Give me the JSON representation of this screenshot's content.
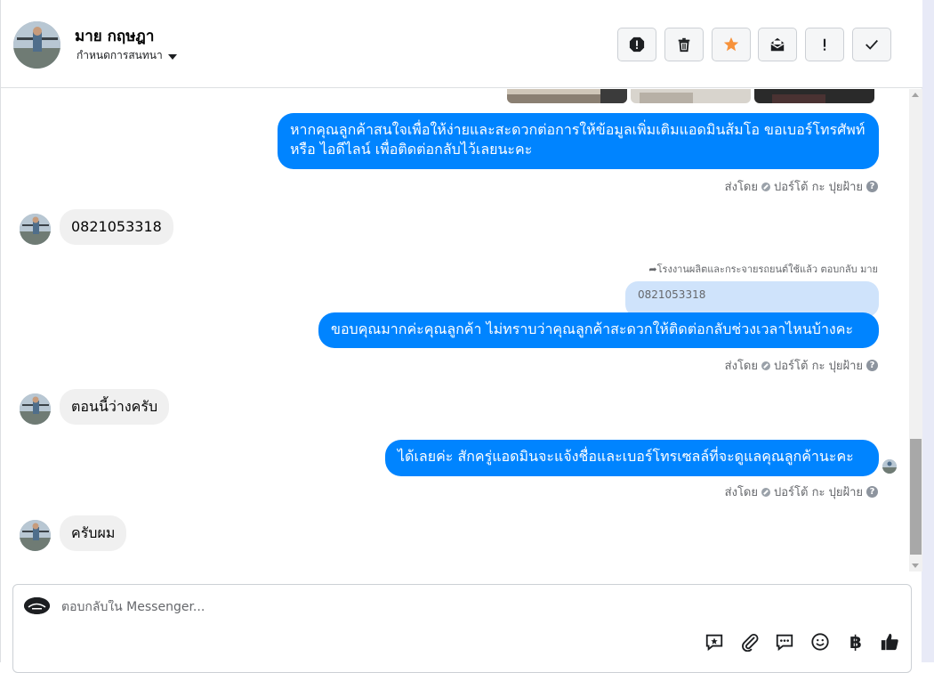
{
  "header": {
    "name": "มาย กฤษฎา",
    "subtitle": "กำหนดการสนทนา"
  },
  "toolbar": [
    {
      "name": "report-icon"
    },
    {
      "name": "trash-icon"
    },
    {
      "name": "star-icon"
    },
    {
      "name": "mark-unread-icon"
    },
    {
      "name": "important-icon"
    },
    {
      "name": "check-icon"
    }
  ],
  "messages": {
    "m1": "หากคุณลูกค้าสนใจเพื่อให้ง่ายและสะดวกต่อการให้ข้อมูลเพิ่มเติมแอดมินส้มโอ ขอเบอร์โทรศัพท์ หรือ ไอดีไลน์ เพื่อติดต่อกลับไว้เลยนะคะ",
    "m2": "0821053318",
    "reply_note": "โรงงานผลิตและกระจายรถยนต์ใช้แล้ว ตอบกลับ มาย",
    "quoted": "0821053318",
    "m3": "ขอบคุณมากค่ะคุณลูกค้า ไม่ทราบว่าคุณลูกค้าสะดวกให้ติดต่อกลับช่วงเวลาไหนบ้างคะ",
    "m4": "ตอนนี้ว่างครับ",
    "m5": "ได้เลยค่ะ สักครู่แอดมินจะแจ้งชื่อและเบอร์โทรเซลล์ที่จะดูแลคุณลูกค้านะคะ",
    "m6": "ครับผม"
  },
  "sent_by": {
    "label": "ส่งโดย",
    "name": "ปอร์โต้ กะ ปุยฝ้าย",
    "help": "?"
  },
  "composer": {
    "placeholder": "ตอบกลับใน Messenger..."
  },
  "composer_icons": [
    "saved-reply-icon",
    "attachment-icon",
    "chat-icon",
    "emoji-icon",
    "baht-icon",
    "thumbs-up-icon"
  ],
  "colors": {
    "accent": "#0084ff",
    "star": "#f7923b"
  }
}
